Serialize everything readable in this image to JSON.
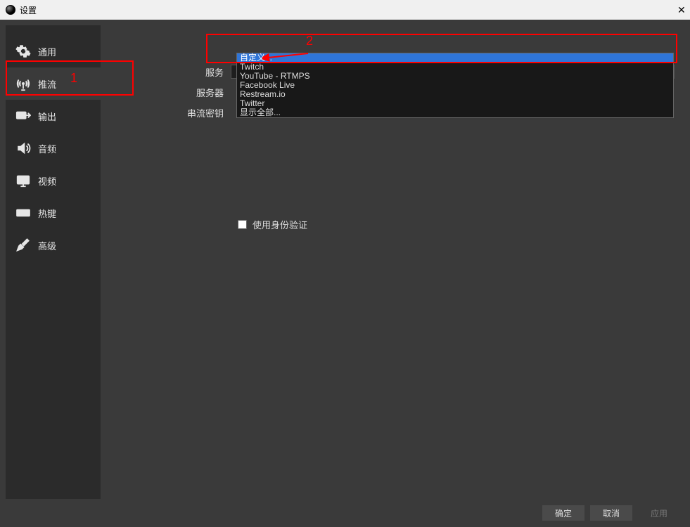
{
  "window": {
    "title": "设置"
  },
  "sidebar": {
    "items": [
      {
        "label": "通用",
        "icon": "gear"
      },
      {
        "label": "推流",
        "icon": "antenna"
      },
      {
        "label": "输出",
        "icon": "output"
      },
      {
        "label": "音频",
        "icon": "audio"
      },
      {
        "label": "视频",
        "icon": "video"
      },
      {
        "label": "热键",
        "icon": "keyboard"
      },
      {
        "label": "高级",
        "icon": "tools"
      }
    ],
    "active_index": 1
  },
  "form": {
    "service_label": "服务",
    "service_value": "自定义...",
    "server_label": "服务器",
    "streamkey_label": "串流密钥",
    "auth_checkbox_label": "使用身份验证",
    "auth_checked": false
  },
  "dropdown_options": [
    "自定义...",
    "Twitch",
    "YouTube - RTMPS",
    "Facebook Live",
    "Restream.io",
    "Twitter",
    "显示全部..."
  ],
  "dropdown_selected_index": 0,
  "annotations": {
    "callout_1": "1",
    "callout_2": "2"
  },
  "footer": {
    "ok": "确定",
    "cancel": "取消",
    "apply": "应用"
  }
}
